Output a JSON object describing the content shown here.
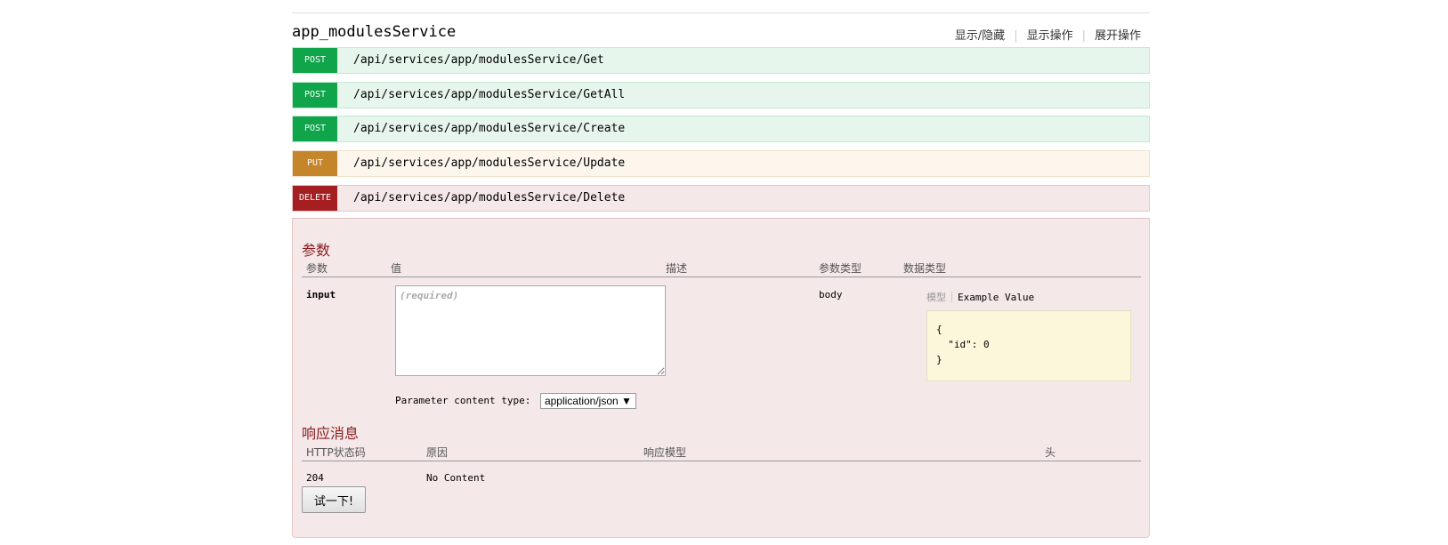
{
  "resource": {
    "title": "app_modulesService",
    "actions": [
      "显示/隐藏",
      "显示操作",
      "展开操作"
    ]
  },
  "operations": [
    {
      "method": "POST",
      "path": "/api/services/app/modulesService/Get"
    },
    {
      "method": "POST",
      "path": "/api/services/app/modulesService/GetAll"
    },
    {
      "method": "POST",
      "path": "/api/services/app/modulesService/Create"
    },
    {
      "method": "PUT",
      "path": "/api/services/app/modulesService/Update"
    },
    {
      "method": "DELETE",
      "path": "/api/services/app/modulesService/Delete"
    }
  ],
  "params": {
    "title": "参数",
    "headers": [
      "参数",
      "值",
      "描述",
      "参数类型",
      "数据类型"
    ],
    "row": {
      "name": "input",
      "placeholder": "(required)",
      "param_type": "body",
      "model_tab": "模型",
      "example_tab": "Example Value",
      "example": "{\n  \"id\": 0\n}"
    },
    "content_type_label": "Parameter content type:",
    "content_type_value": "application/json"
  },
  "responses": {
    "title": "响应消息",
    "headers": [
      "HTTP状态码",
      "原因",
      "响应模型",
      "头"
    ],
    "row": {
      "code": "204",
      "reason": "No Content"
    }
  },
  "try_button": "试一下!"
}
